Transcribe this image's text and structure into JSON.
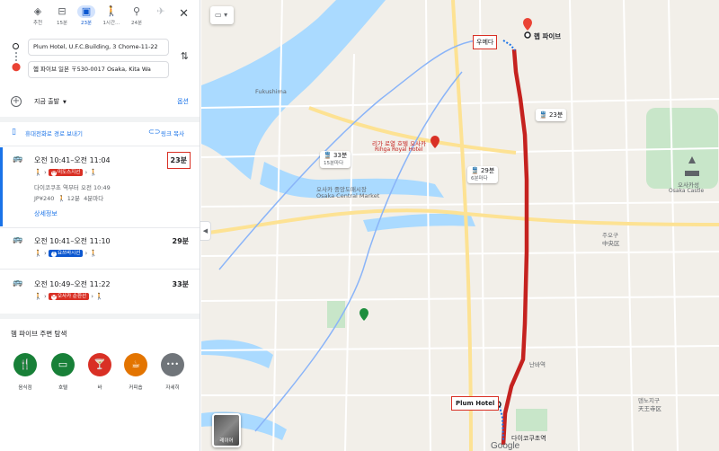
{
  "modes": [
    {
      "name": "recommended",
      "label": "추천",
      "icon": "◈"
    },
    {
      "name": "car",
      "label": "15분",
      "icon": "🚗"
    },
    {
      "name": "transit",
      "label": "23분",
      "icon": "🚆",
      "active": true
    },
    {
      "name": "walk",
      "label": "1시간…",
      "icon": "🚶"
    },
    {
      "name": "bike",
      "label": "24분",
      "icon": "🚲"
    },
    {
      "name": "flight",
      "label": "",
      "icon": "✈"
    }
  ],
  "close_icon": "✕",
  "origin": "Plum Hotel, U.F.C.Building, 3 Chome-11-22",
  "destination": "헴 파이브 일본 〒530-0017 Osaka, Kita Wa",
  "depart_label": "지금 출발",
  "options_label": "옵션",
  "send_label": "휴대전화로 경로 보내기",
  "link_label": "링크 복사",
  "routes": [
    {
      "time": "오전 10:41–오전 11:04",
      "duration": "23분",
      "badge": "미도스지선",
      "badge_icon": "M",
      "sub1": "다이코쿠초 역부터 오전 10:49",
      "sub2_fare": "JP¥240",
      "sub2_walk": "12분",
      "sub2_freq": "4분마다",
      "detail": "상세정보"
    },
    {
      "time": "오전 10:41–오전 11:10",
      "duration": "29분",
      "badge": "요쓰바시선",
      "badge_icon": "Y"
    },
    {
      "time": "오전 10:49–오전 11:22",
      "duration": "33분",
      "badge": "오사카 순환선",
      "badge_icon": "O"
    }
  ],
  "explore_title": "헴 파이브 주변 탐색",
  "categories": [
    {
      "label": "음식점",
      "icon": "🍴",
      "color": "#188038"
    },
    {
      "label": "호텔",
      "icon": "🛏",
      "color": "#188038"
    },
    {
      "label": "바",
      "icon": "🍸",
      "color": "#d93025"
    },
    {
      "label": "커피숍",
      "icon": "☕",
      "color": "#e37400"
    },
    {
      "label": "자세히",
      "icon": "•••",
      "color": "#70757a"
    }
  ],
  "map": {
    "labels": {
      "umeda": "우메다",
      "hep": "헵 파이브",
      "plum": "Plum Hotel",
      "daikokucho": "다이코쿠초역",
      "fukushima": "Fukushima",
      "royal": "리가 로열 호텔 오사카",
      "royal_en": "Rihga Royal Hotel",
      "market": "오사카 중앙도매시장",
      "market_en": "Osaka Central Market",
      "osakajo": "오사카성",
      "osakajo_en": "Osaka Castle",
      "namba": "난바역",
      "tennoji": "덴노지구",
      "tennoji_jp": "天王寺区",
      "chuo": "주오구",
      "chuo_jp": "中央区",
      "layer": "레이어",
      "route_23": "23분",
      "route_29": "29분",
      "route_29_sub": "6분마다",
      "route_33": "33분",
      "route_33_sub": "15분마다",
      "google": "Google"
    }
  }
}
